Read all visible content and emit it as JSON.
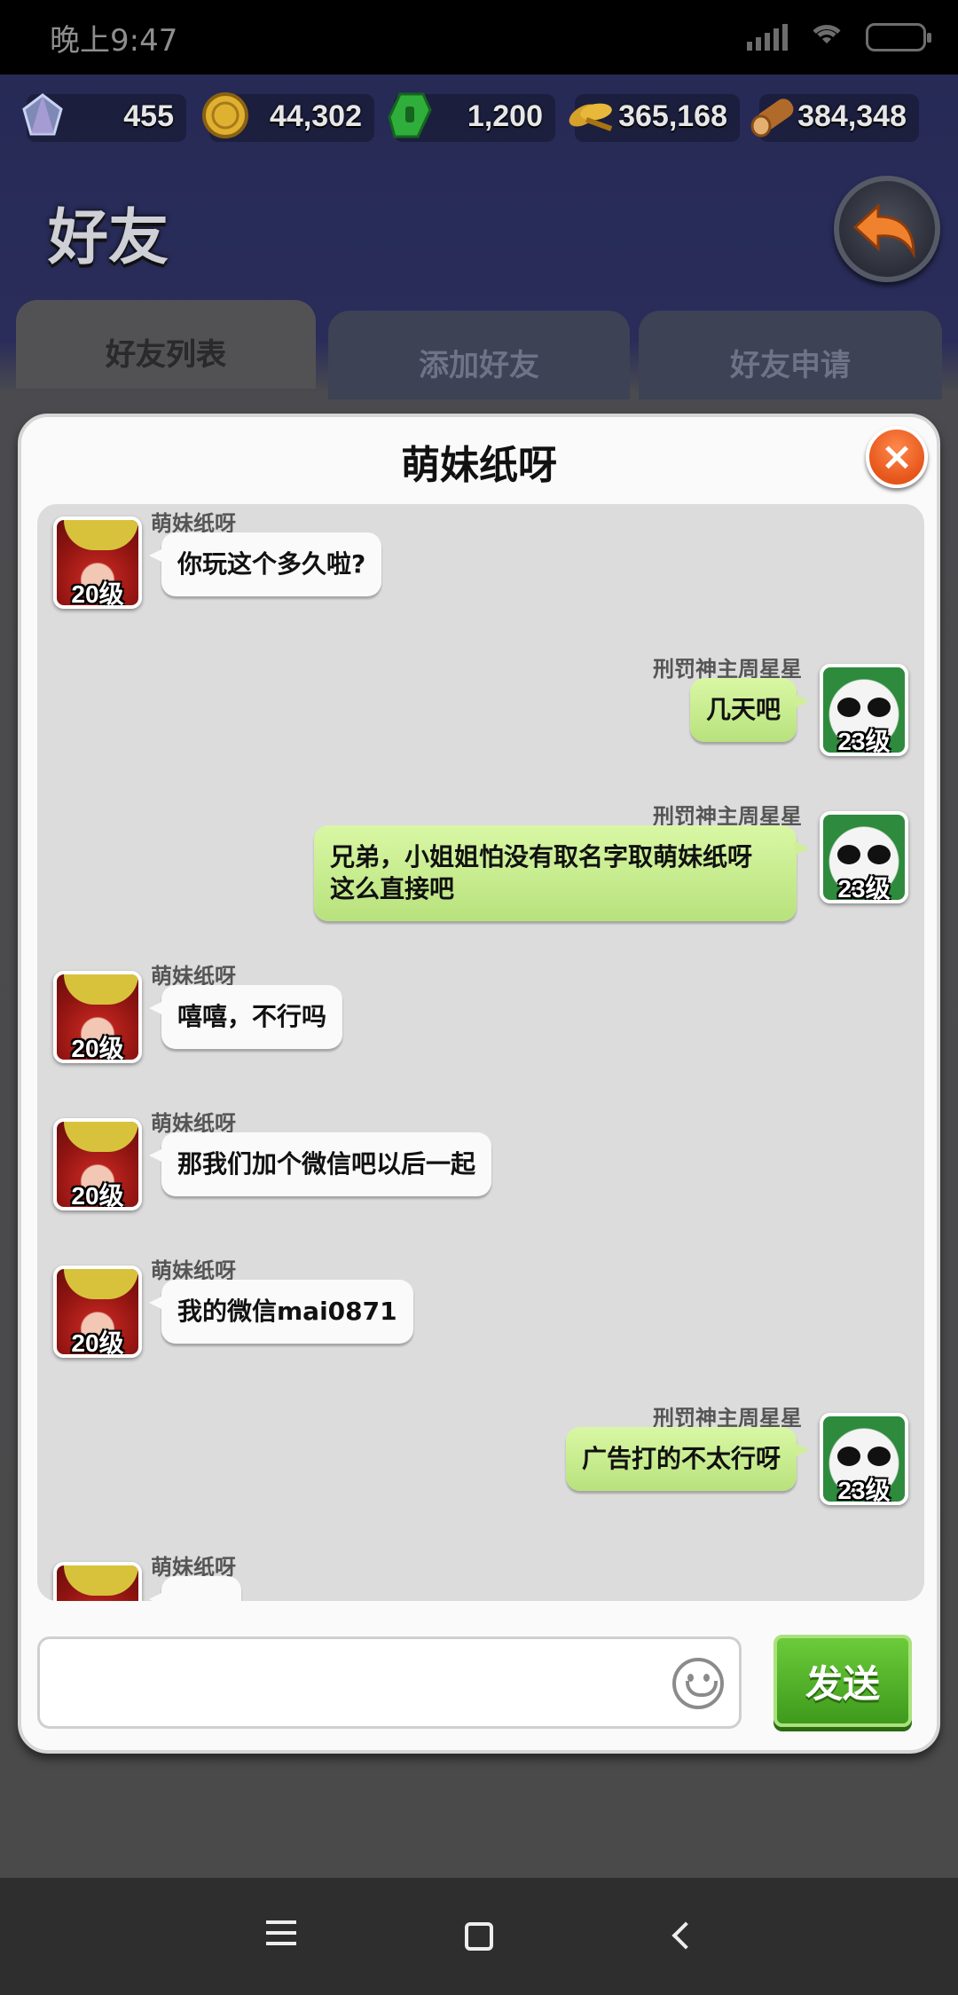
{
  "status_bar": {
    "time": "晚上9:47"
  },
  "resources": [
    {
      "name": "gem",
      "value": "455",
      "color": "#9aa4c9"
    },
    {
      "name": "coin",
      "value": "44,302",
      "color": "#e0b030"
    },
    {
      "name": "token",
      "value": "1,200",
      "color": "#2fae3c"
    },
    {
      "name": "wheat",
      "value": "365,168",
      "color": "#d6a12a"
    },
    {
      "name": "wood",
      "value": "384,348",
      "color": "#b06b2a"
    }
  ],
  "page": {
    "title": "好友"
  },
  "tabs": [
    {
      "label": "好友列表",
      "active": true
    },
    {
      "label": "添加好友",
      "active": false
    },
    {
      "label": "好友申请",
      "active": false
    }
  ],
  "dialog": {
    "title": "萌妹纸呀",
    "close_icon": "×",
    "messages": [
      {
        "side": "left",
        "sender": "萌妹纸呀",
        "level": "20级",
        "text": "你玩这个多久啦?"
      },
      {
        "side": "right",
        "sender": "刑罚神主周星星",
        "level": "23级",
        "text": "几天吧"
      },
      {
        "side": "right",
        "sender": "刑罚神主周星星",
        "level": "23级",
        "text": "兄弟，小姐姐怕没有取名字取萌妹纸呀\n这么直接吧"
      },
      {
        "side": "left",
        "sender": "萌妹纸呀",
        "level": "20级",
        "text": "嘻嘻，不行吗"
      },
      {
        "side": "left",
        "sender": "萌妹纸呀",
        "level": "20级",
        "text": "那我们加个微信吧以后一起"
      },
      {
        "side": "left",
        "sender": "萌妹纸呀",
        "level": "20级",
        "text": "我的微信mai0871"
      },
      {
        "side": "right",
        "sender": "刑罚神主周星星",
        "level": "23级",
        "text": "广告打的不太行呀"
      },
      {
        "side": "left",
        "sender": "萌妹纸呀",
        "level": "",
        "text": ""
      }
    ],
    "input": {
      "placeholder": "",
      "value": ""
    },
    "send_label": "发送"
  },
  "colors": {
    "accent_green": "#4aa822",
    "close_orange": "#f26a2a",
    "bubble_green": "#c8ec8e"
  }
}
